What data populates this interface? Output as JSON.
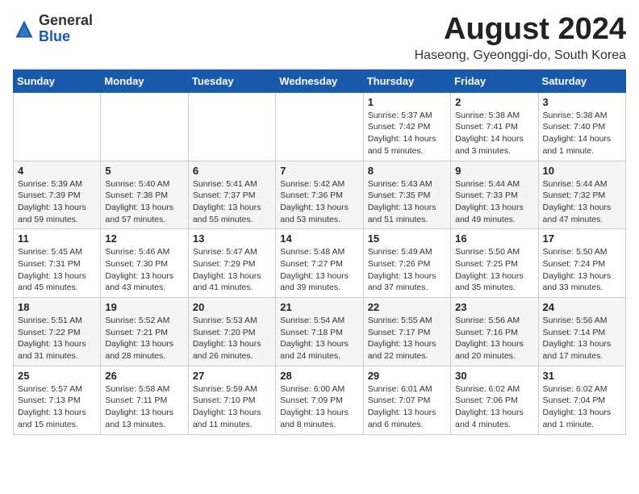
{
  "header": {
    "logo_general": "General",
    "logo_blue": "Blue",
    "month_year": "August 2024",
    "location": "Haseong, Gyeonggi-do, South Korea"
  },
  "weekdays": [
    "Sunday",
    "Monday",
    "Tuesday",
    "Wednesday",
    "Thursday",
    "Friday",
    "Saturday"
  ],
  "weeks": [
    [
      {
        "day": "",
        "info": ""
      },
      {
        "day": "",
        "info": ""
      },
      {
        "day": "",
        "info": ""
      },
      {
        "day": "",
        "info": ""
      },
      {
        "day": "1",
        "info": "Sunrise: 5:37 AM\nSunset: 7:42 PM\nDaylight: 14 hours\nand 5 minutes."
      },
      {
        "day": "2",
        "info": "Sunrise: 5:38 AM\nSunset: 7:41 PM\nDaylight: 14 hours\nand 3 minutes."
      },
      {
        "day": "3",
        "info": "Sunrise: 5:38 AM\nSunset: 7:40 PM\nDaylight: 14 hours\nand 1 minute."
      }
    ],
    [
      {
        "day": "4",
        "info": "Sunrise: 5:39 AM\nSunset: 7:39 PM\nDaylight: 13 hours\nand 59 minutes."
      },
      {
        "day": "5",
        "info": "Sunrise: 5:40 AM\nSunset: 7:38 PM\nDaylight: 13 hours\nand 57 minutes."
      },
      {
        "day": "6",
        "info": "Sunrise: 5:41 AM\nSunset: 7:37 PM\nDaylight: 13 hours\nand 55 minutes."
      },
      {
        "day": "7",
        "info": "Sunrise: 5:42 AM\nSunset: 7:36 PM\nDaylight: 13 hours\nand 53 minutes."
      },
      {
        "day": "8",
        "info": "Sunrise: 5:43 AM\nSunset: 7:35 PM\nDaylight: 13 hours\nand 51 minutes."
      },
      {
        "day": "9",
        "info": "Sunrise: 5:44 AM\nSunset: 7:33 PM\nDaylight: 13 hours\nand 49 minutes."
      },
      {
        "day": "10",
        "info": "Sunrise: 5:44 AM\nSunset: 7:32 PM\nDaylight: 13 hours\nand 47 minutes."
      }
    ],
    [
      {
        "day": "11",
        "info": "Sunrise: 5:45 AM\nSunset: 7:31 PM\nDaylight: 13 hours\nand 45 minutes."
      },
      {
        "day": "12",
        "info": "Sunrise: 5:46 AM\nSunset: 7:30 PM\nDaylight: 13 hours\nand 43 minutes."
      },
      {
        "day": "13",
        "info": "Sunrise: 5:47 AM\nSunset: 7:29 PM\nDaylight: 13 hours\nand 41 minutes."
      },
      {
        "day": "14",
        "info": "Sunrise: 5:48 AM\nSunset: 7:27 PM\nDaylight: 13 hours\nand 39 minutes."
      },
      {
        "day": "15",
        "info": "Sunrise: 5:49 AM\nSunset: 7:26 PM\nDaylight: 13 hours\nand 37 minutes."
      },
      {
        "day": "16",
        "info": "Sunrise: 5:50 AM\nSunset: 7:25 PM\nDaylight: 13 hours\nand 35 minutes."
      },
      {
        "day": "17",
        "info": "Sunrise: 5:50 AM\nSunset: 7:24 PM\nDaylight: 13 hours\nand 33 minutes."
      }
    ],
    [
      {
        "day": "18",
        "info": "Sunrise: 5:51 AM\nSunset: 7:22 PM\nDaylight: 13 hours\nand 31 minutes."
      },
      {
        "day": "19",
        "info": "Sunrise: 5:52 AM\nSunset: 7:21 PM\nDaylight: 13 hours\nand 28 minutes."
      },
      {
        "day": "20",
        "info": "Sunrise: 5:53 AM\nSunset: 7:20 PM\nDaylight: 13 hours\nand 26 minutes."
      },
      {
        "day": "21",
        "info": "Sunrise: 5:54 AM\nSunset: 7:18 PM\nDaylight: 13 hours\nand 24 minutes."
      },
      {
        "day": "22",
        "info": "Sunrise: 5:55 AM\nSunset: 7:17 PM\nDaylight: 13 hours\nand 22 minutes."
      },
      {
        "day": "23",
        "info": "Sunrise: 5:56 AM\nSunset: 7:16 PM\nDaylight: 13 hours\nand 20 minutes."
      },
      {
        "day": "24",
        "info": "Sunrise: 5:56 AM\nSunset: 7:14 PM\nDaylight: 13 hours\nand 17 minutes."
      }
    ],
    [
      {
        "day": "25",
        "info": "Sunrise: 5:57 AM\nSunset: 7:13 PM\nDaylight: 13 hours\nand 15 minutes."
      },
      {
        "day": "26",
        "info": "Sunrise: 5:58 AM\nSunset: 7:11 PM\nDaylight: 13 hours\nand 13 minutes."
      },
      {
        "day": "27",
        "info": "Sunrise: 5:59 AM\nSunset: 7:10 PM\nDaylight: 13 hours\nand 11 minutes."
      },
      {
        "day": "28",
        "info": "Sunrise: 6:00 AM\nSunset: 7:09 PM\nDaylight: 13 hours\nand 8 minutes."
      },
      {
        "day": "29",
        "info": "Sunrise: 6:01 AM\nSunset: 7:07 PM\nDaylight: 13 hours\nand 6 minutes."
      },
      {
        "day": "30",
        "info": "Sunrise: 6:02 AM\nSunset: 7:06 PM\nDaylight: 13 hours\nand 4 minutes."
      },
      {
        "day": "31",
        "info": "Sunrise: 6:02 AM\nSunset: 7:04 PM\nDaylight: 13 hours\nand 1 minute."
      }
    ]
  ]
}
